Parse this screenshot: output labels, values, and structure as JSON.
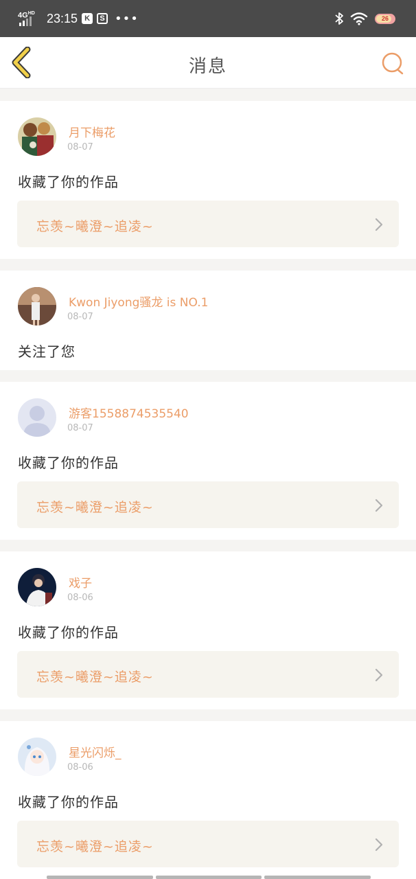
{
  "status_bar": {
    "network": "4G",
    "network_sup": "HD",
    "time": "23:15",
    "icons": [
      "signal-icon",
      "k-app-icon",
      "s-app-icon",
      "more-dots-icon",
      "bluetooth-icon",
      "wifi-icon",
      "battery-icon"
    ]
  },
  "header": {
    "title": "消息",
    "back_icon": "back-chevron-icon",
    "search_icon": "search-icon"
  },
  "colors": {
    "accent": "#eb9d68",
    "back_icon_fill": "#f1d04a",
    "background": "#f5f4f2",
    "work_box": "#f6f4ee"
  },
  "messages": [
    {
      "user": "月下梅花",
      "date": "08-07",
      "action": "收藏了你的作品",
      "work": "忘羡~曦澄~追凌~"
    },
    {
      "user": "Kwon Jiyong骚龙 is NO.1",
      "date": "08-07",
      "action": "关注了您"
    },
    {
      "user": "游客1558874535540",
      "date": "08-07",
      "action": "收藏了你的作品",
      "work": "忘羡~曦澄~追凌~"
    },
    {
      "user": "戏子",
      "date": "08-06",
      "action": "收藏了你的作品",
      "work": "忘羡~曦澄~追凌~"
    },
    {
      "user": "星光闪烁_",
      "date": "08-06",
      "action": "收藏了你的作品",
      "work": "忘羡~曦澄~追凌~"
    }
  ]
}
